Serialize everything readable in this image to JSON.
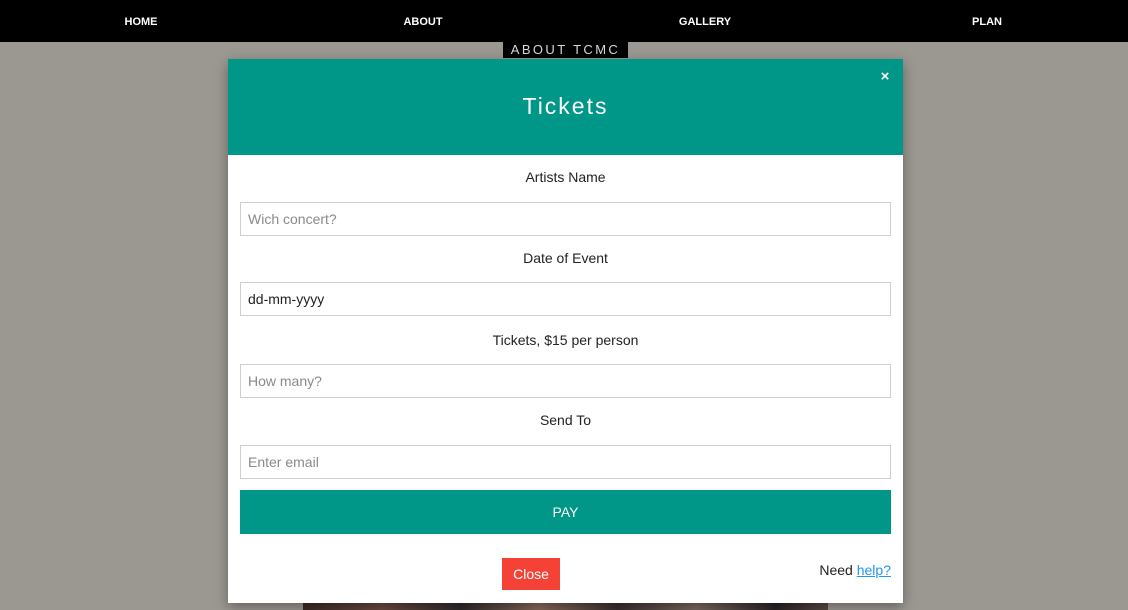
{
  "nav": {
    "items": [
      {
        "label": "HOME"
      },
      {
        "label": "ABOUT"
      },
      {
        "label": "GALLERY"
      },
      {
        "label": "PLAN"
      }
    ]
  },
  "banner": {
    "text": "ABOUT TCMC"
  },
  "modal": {
    "title": "Tickets",
    "close_icon": "×",
    "fields": {
      "artist": {
        "label": "Artists Name",
        "placeholder": "Wich concert?"
      },
      "date": {
        "label": "Date of Event",
        "value": "dd-mm-yyyy"
      },
      "tickets": {
        "label": "Tickets, $15 per person",
        "placeholder": "How many?"
      },
      "email": {
        "label": "Send To",
        "placeholder": "Enter email"
      }
    },
    "pay_label": "PAY",
    "close_label": "Close",
    "help": {
      "prefix": "Need ",
      "link": "help?"
    }
  },
  "colors": {
    "accent": "#009688",
    "danger": "#f44336",
    "link": "#2196f3",
    "navbar": "#000000",
    "backdrop": "#9b9791"
  }
}
